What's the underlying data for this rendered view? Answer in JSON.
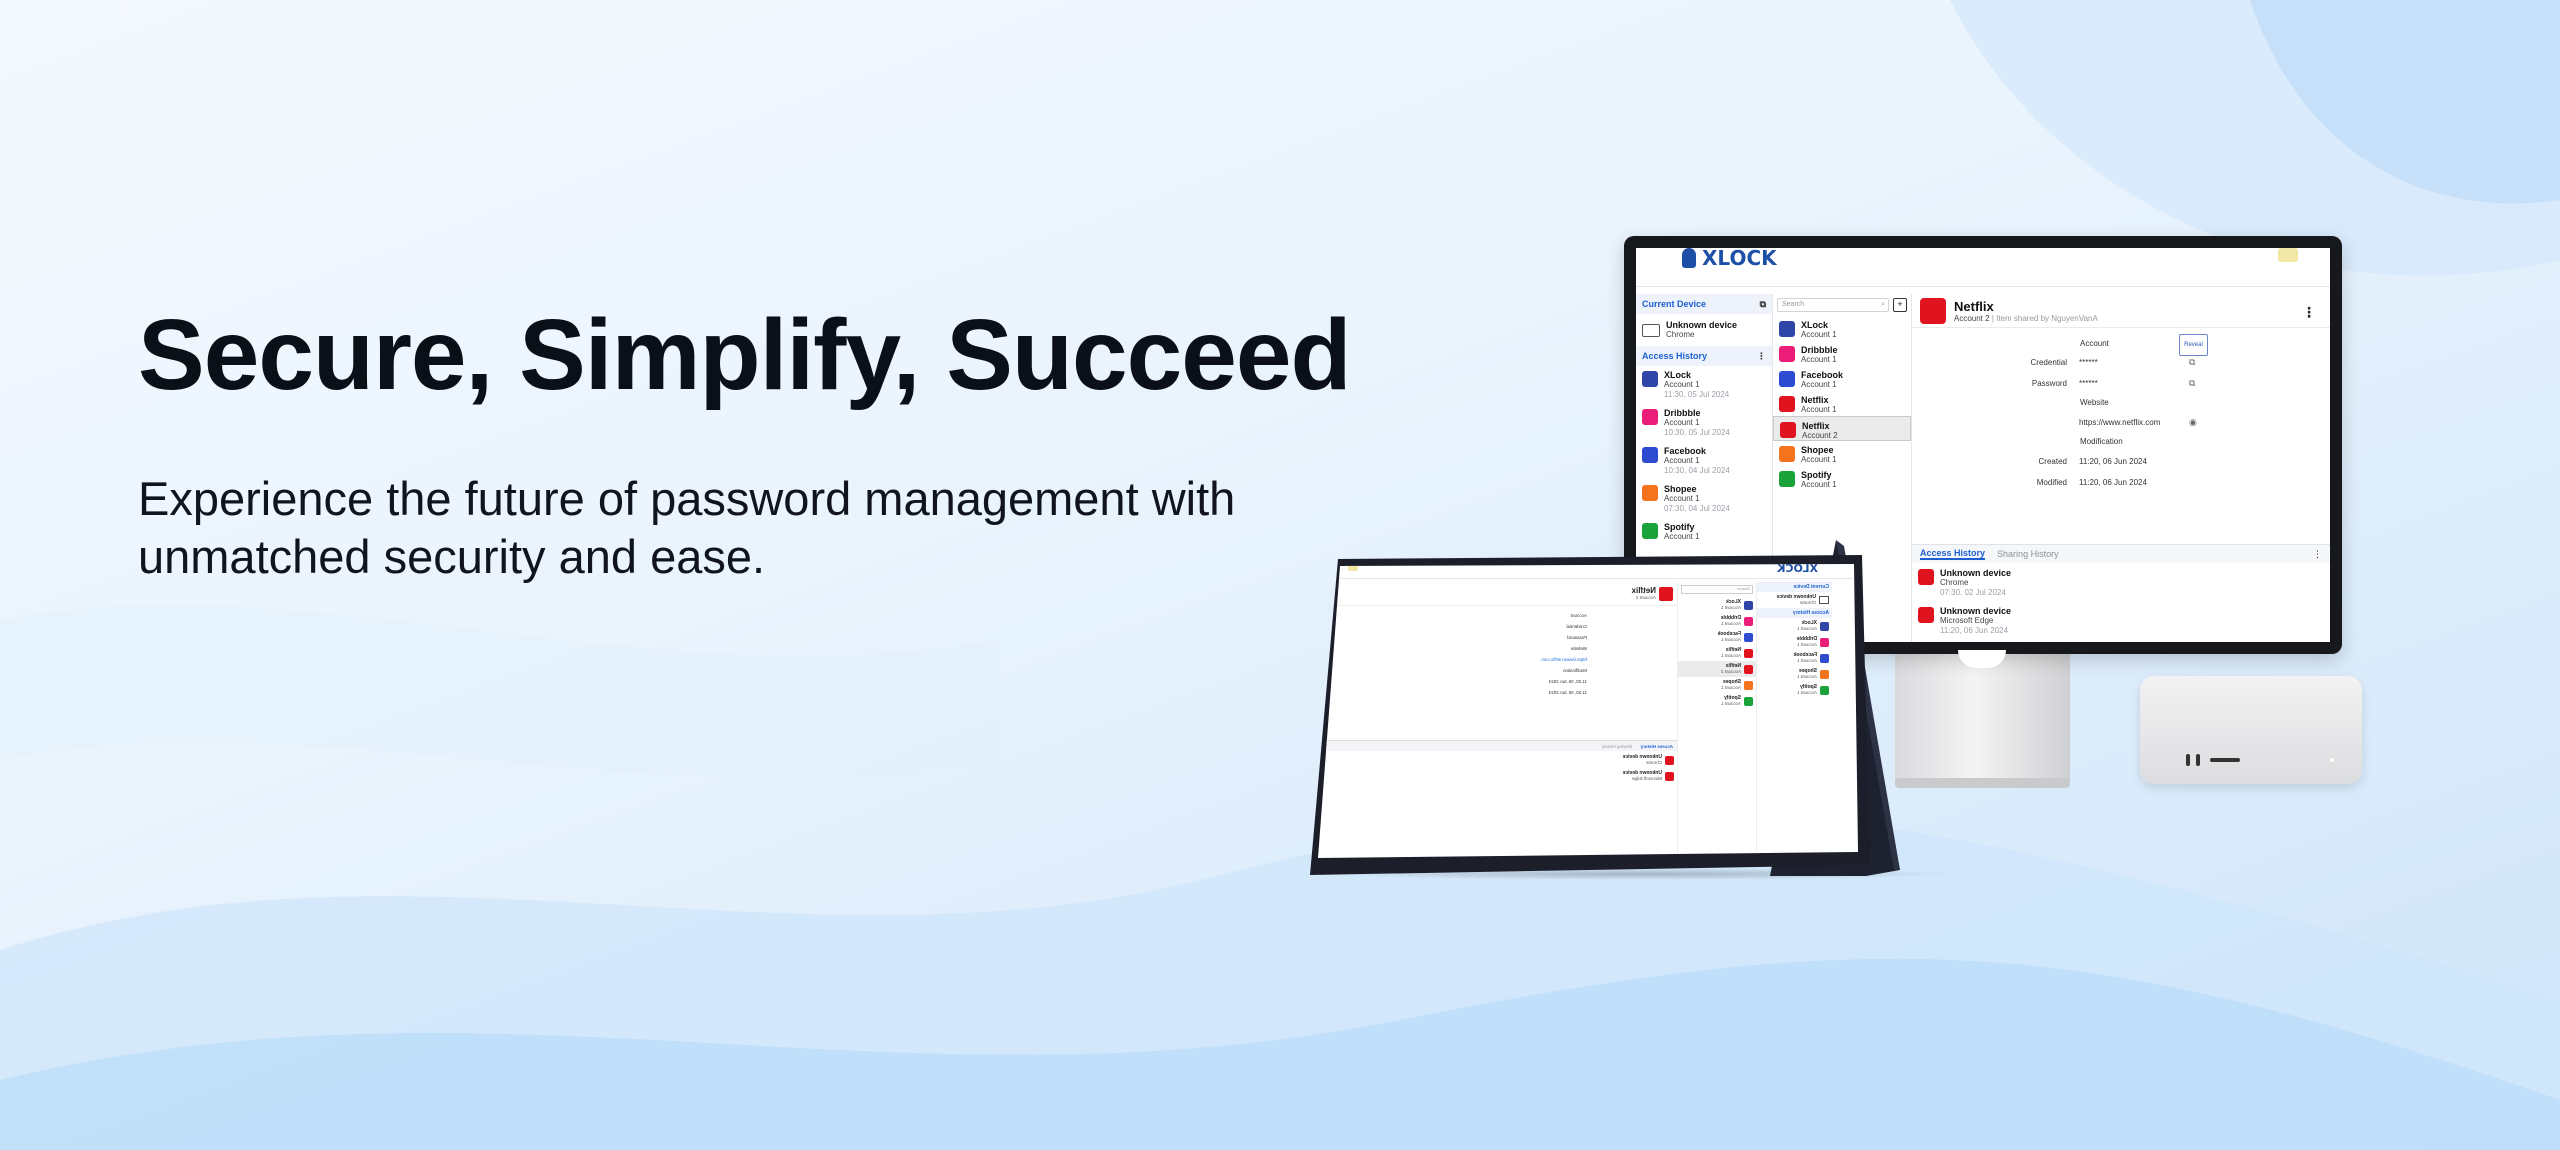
{
  "hero": {
    "title": "Secure, Simplify, Succeed",
    "subtitle": "Experience the future of password management with unmatched security and ease."
  },
  "app": {
    "logo_text": "XLOCK",
    "current_device": {
      "heading": "Current Device",
      "device_name": "Unknown device",
      "browser": "Chrome"
    },
    "access_history_heading": "Access History",
    "access_history": [
      {
        "name": "XLock",
        "account": "Account 1",
        "time": "11:30, 05 Jul 2024",
        "color": "#2f46a8"
      },
      {
        "name": "Dribbble",
        "account": "Account 1",
        "time": "10:30, 05 Jul 2024",
        "color": "#ea1e78"
      },
      {
        "name": "Facebook",
        "account": "Account 1",
        "time": "10:30, 04 Jul 2024",
        "color": "#2e4bd1"
      },
      {
        "name": "Shopee",
        "account": "Account 1",
        "time": "07:30, 04 Jul 2024",
        "color": "#f5731c"
      },
      {
        "name": "Spotify",
        "account": "Account 1",
        "time": "",
        "color": "#1aa33a"
      }
    ],
    "search_placeholder": "Search",
    "items": [
      {
        "name": "XLock",
        "account": "Account 1",
        "color": "#2f46a8",
        "selected": false
      },
      {
        "name": "Dribbble",
        "account": "Account 1",
        "color": "#ea1e78",
        "selected": false
      },
      {
        "name": "Facebook",
        "account": "Account 1",
        "color": "#2e4bd1",
        "selected": false
      },
      {
        "name": "Netflix",
        "account": "Account 1",
        "color": "#e0141e",
        "selected": false
      },
      {
        "name": "Netflix",
        "account": "Account 2",
        "color": "#e0141e",
        "selected": true
      },
      {
        "name": "Shopee",
        "account": "Account 1",
        "color": "#f5731c",
        "selected": false
      },
      {
        "name": "Spotify",
        "account": "Account 1",
        "color": "#1aa33a",
        "selected": false
      }
    ],
    "detail": {
      "title": "Netflix",
      "account": "Account 2",
      "shared_note": "| Item shared by NguyenVanA",
      "account_label": "Account",
      "reveal_label": "Reveal",
      "credential_label": "Credential",
      "credential_value": "******",
      "password_label": "Password",
      "password_value": "******",
      "website_label": "Website",
      "website_value": "https://www.netflix.com",
      "modification_label": "Modification",
      "created_label": "Created",
      "created_value": "11:20, 06 Jun 2024",
      "modified_label": "Modified",
      "modified_value": "11:20, 06 Jun 2024"
    },
    "history_tabs": {
      "access": "Access History",
      "sharing": "Sharing History"
    },
    "history_entries": [
      {
        "device": "Unknown device",
        "browser": "Chrome",
        "time": "07:30, 02 Jul 2024"
      },
      {
        "device": "Unknown device",
        "browser": "Microsoft Edge",
        "time": "11:20, 06 Jun 2024"
      }
    ]
  },
  "colors": {
    "accent": "#1d5fd0",
    "netflix": "#e0141e",
    "text": "#0b0f17"
  }
}
